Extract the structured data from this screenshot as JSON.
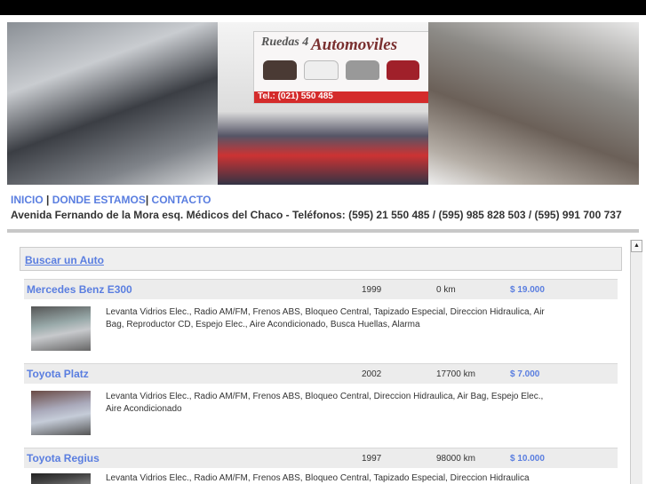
{
  "banner": {
    "sign_brand": "Ruedas 4",
    "sign_title": "Automoviles",
    "sign_phone": "Tel.: (021) 550 485"
  },
  "nav": {
    "items": [
      {
        "label": "INICIO"
      },
      {
        "label": "DONDE ESTAMOS"
      },
      {
        "label": "CONTACTO"
      }
    ],
    "sep": "|"
  },
  "address": "Avenida Fernando de la Mora esq. Médicos del Chaco - Teléfonos: (595) 21 550 485 / (595) 985 828 503 / (595) 991 700 737",
  "search_link": "Buscar un Auto",
  "cars": [
    {
      "name": "Mercedes Benz E300",
      "year": "1999",
      "km": "0 km",
      "price": "$ 19.000",
      "features": "Levanta Vidrios Elec., Radio AM/FM, Frenos ABS, Bloqueo Central, Tapizado Especial, Direccion Hidraulica, Air Bag, Reproductor CD, Espejo Elec., Aire Acondicionado, Busca Huellas, Alarma"
    },
    {
      "name": "Toyota Platz",
      "year": "2002",
      "km": "17700 km",
      "price": "$ 7.000",
      "features": "Levanta Vidrios Elec., Radio AM/FM, Frenos ABS, Bloqueo Central, Direccion Hidraulica, Air Bag, Espejo Elec., Aire Acondicionado"
    },
    {
      "name": "Toyota Regius",
      "year": "1997",
      "km": "98000 km",
      "price": "$ 10.000",
      "features": "Levanta Vidrios Elec., Radio AM/FM, Frenos ABS, Bloqueo Central, Tapizado Especial, Direccion Hidraulica"
    }
  ]
}
